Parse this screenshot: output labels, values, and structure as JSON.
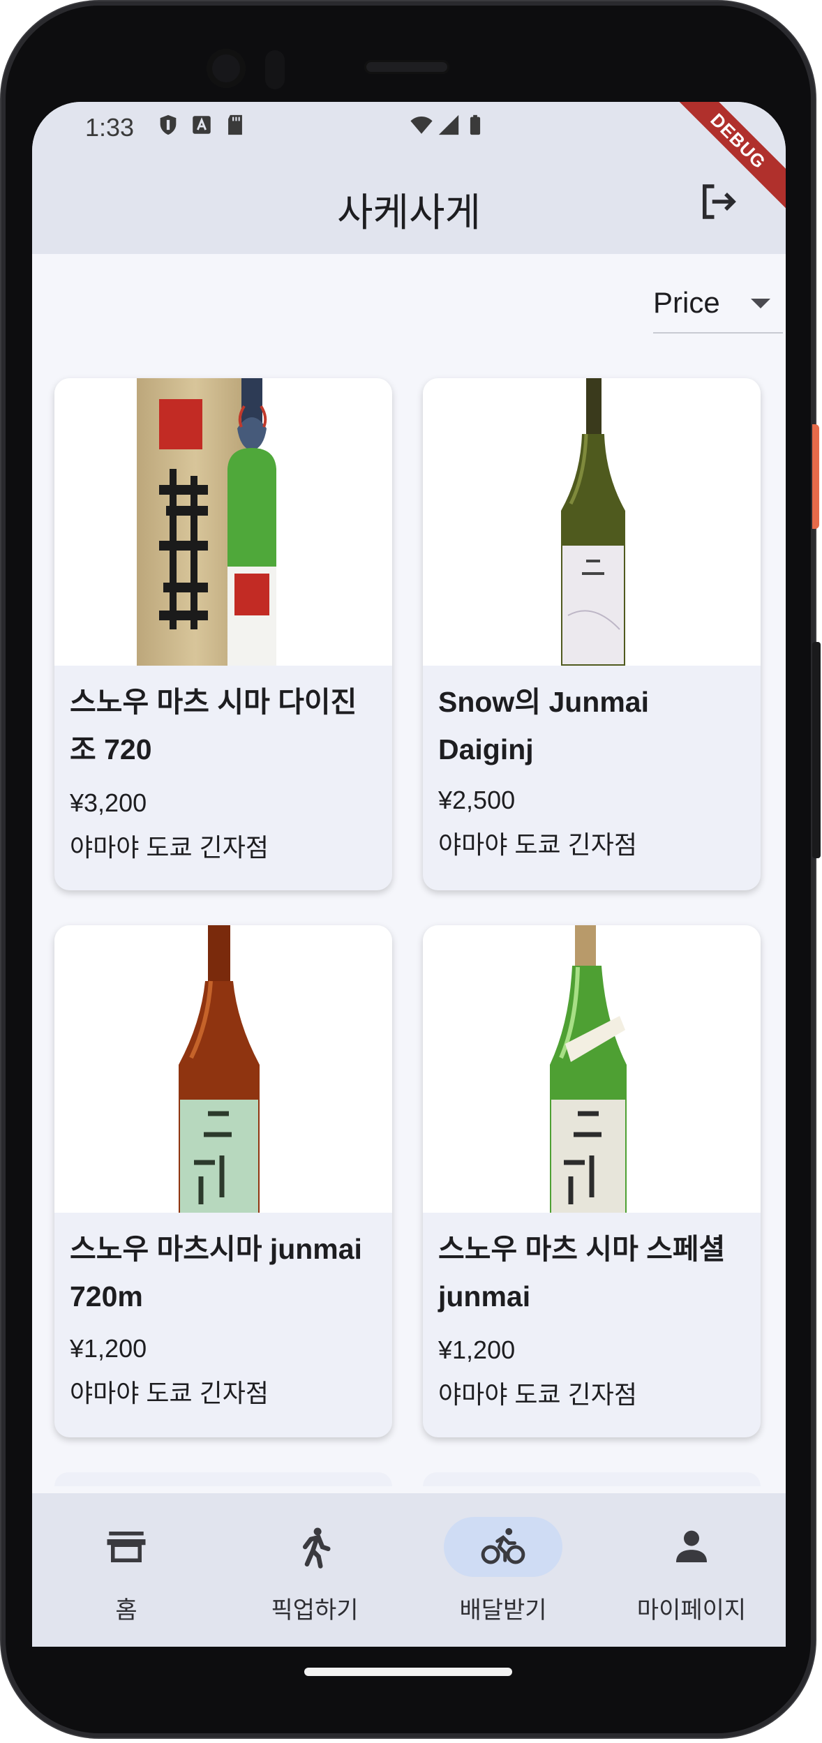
{
  "status_bar": {
    "time": "1:33"
  },
  "app_bar": {
    "title": "사케사게",
    "debug_label": "DEBUG"
  },
  "sort": {
    "selected": "Price"
  },
  "products": [
    {
      "name": "스노우 마츠 시마 다이진 조 720",
      "price": "¥3,200",
      "store": "야마야 도쿄 긴자점"
    },
    {
      "name": "Snow의 Junmai Daiginj",
      "price": "¥2,500",
      "store": "야마야 도쿄 긴자점"
    },
    {
      "name": "스노우 마츠시마 junmai 720m",
      "price": "¥1,200",
      "store": "야마야 도쿄 긴자점"
    },
    {
      "name": "스노우 마츠 시마 스페셜 junmai",
      "price": "¥1,200",
      "store": "야마야 도쿄 긴자점"
    }
  ],
  "bottom_nav": {
    "items": [
      {
        "label": "홈",
        "icon": "store-icon"
      },
      {
        "label": "픽업하기",
        "icon": "walk-icon"
      },
      {
        "label": "배달받기",
        "icon": "bike-icon"
      },
      {
        "label": "마이페이지",
        "icon": "person-icon"
      }
    ],
    "active_index": 2
  },
  "colors": {
    "app_bar": "#e1e4ee",
    "background": "#f5f6fb",
    "active_pill": "#cfdcf4",
    "debug_ribbon": "#b0302c"
  }
}
